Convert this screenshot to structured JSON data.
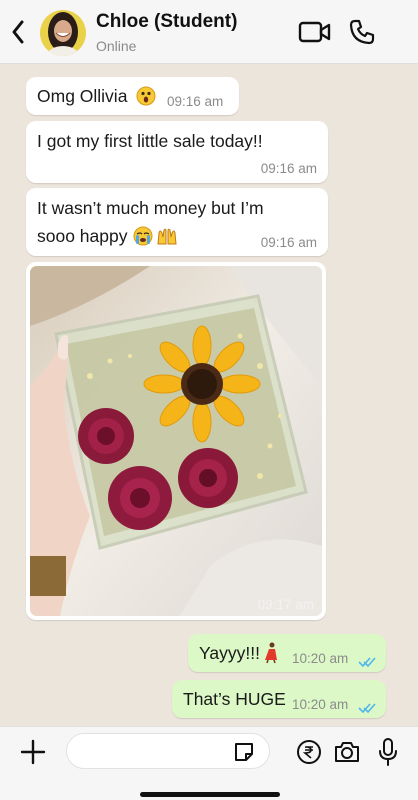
{
  "header": {
    "contact_name": "Chloe (Student)",
    "status": "Online",
    "icons": [
      "back-chevron-icon",
      "video-call-icon",
      "phone-call-icon"
    ]
  },
  "messages": [
    {
      "direction": "in",
      "text": "Omg Ollivia",
      "emoji": "astonished-face",
      "time": "09:16 am"
    },
    {
      "direction": "in",
      "text": "I got my first little sale today!!",
      "time": "09:16 am"
    },
    {
      "direction": "in",
      "text_line1": "It wasn’t much money but I’m",
      "text_line2": "sooo happy",
      "emoji": [
        "crying-face",
        "raising-hands"
      ],
      "time": "09:16 am"
    },
    {
      "direction": "in",
      "type": "image",
      "image_desc": "resin block with pressed sunflower and red roses",
      "time": "09:17 am"
    },
    {
      "direction": "out",
      "text": "Yayyy!!!",
      "emoji": "dancer",
      "time": "10:20 am",
      "status": "read"
    },
    {
      "direction": "out",
      "text": "That’s HUGE",
      "time": "10:20 am",
      "status": "read"
    }
  ],
  "composer": {
    "placeholder": "",
    "icons": [
      "plus-icon",
      "sticker-icon",
      "rupee-payment-icon",
      "camera-icon",
      "microphone-icon"
    ]
  },
  "colors": {
    "incoming_bubble": "#ffffff",
    "outgoing_bubble": "#dcf8c6",
    "chat_background": "#ece5dc",
    "read_ticks": "#4fb6ec"
  }
}
